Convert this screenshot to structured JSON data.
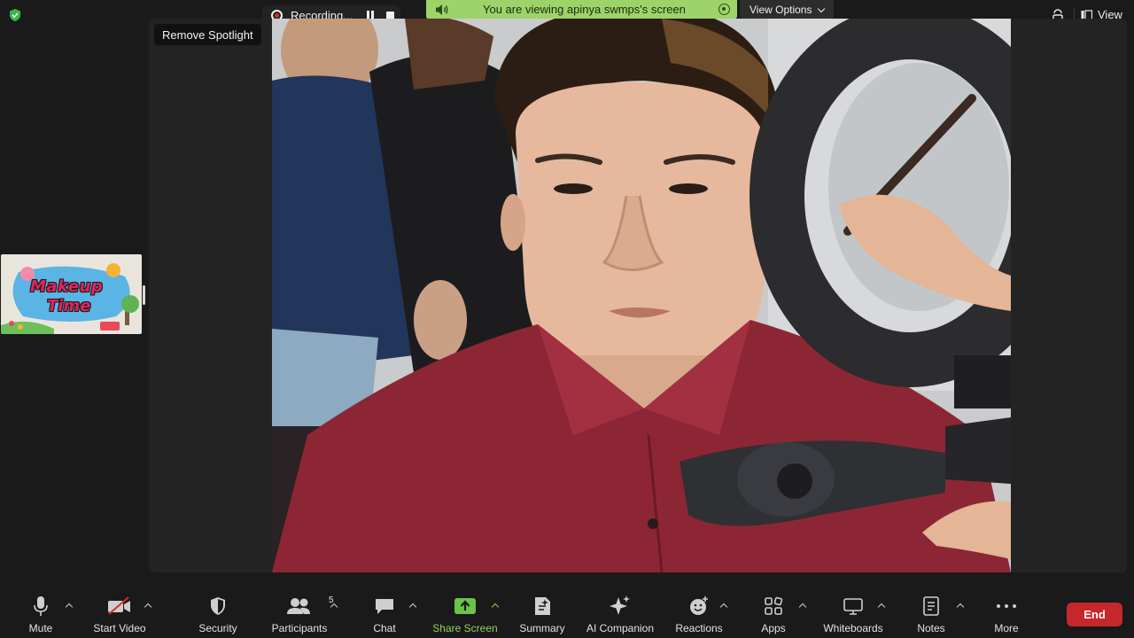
{
  "topbar": {
    "recording_label": "Recording...",
    "share_banner_text": "You are viewing apinya swmps's screen",
    "view_options_label": "View Options",
    "view_label": "View"
  },
  "main": {
    "remove_spotlight_label": "Remove Spotlight"
  },
  "thumbnail": {
    "title_line1": "Makeup",
    "title_line2": "Time"
  },
  "toolbar": {
    "mute_label": "Mute",
    "start_video_label": "Start Video",
    "security_label": "Security",
    "participants_label": "Participants",
    "participants_count": "5",
    "chat_label": "Chat",
    "share_screen_label": "Share Screen",
    "summary_label": "Summary",
    "ai_companion_label": "AI Companion",
    "reactions_label": "Reactions",
    "apps_label": "Apps",
    "whiteboards_label": "Whiteboards",
    "notes_label": "Notes",
    "more_label": "More",
    "end_label": "End"
  },
  "colors": {
    "share_banner": "#9ed36a",
    "share_accent": "#8fd35c",
    "end_button": "#c6272b",
    "recording_dot": "#e02828"
  }
}
